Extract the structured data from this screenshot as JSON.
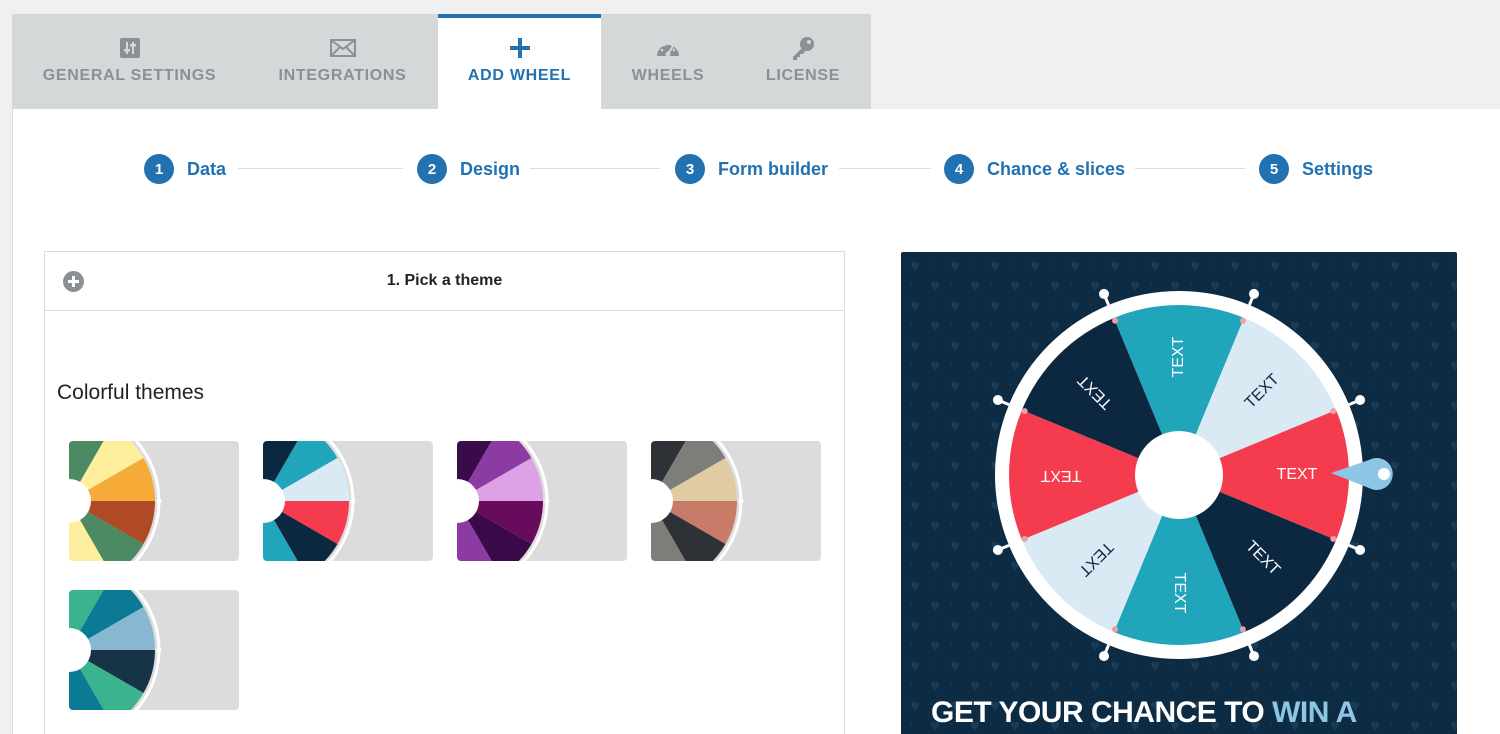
{
  "tabs": [
    {
      "label": "GENERAL SETTINGS",
      "icon": "sliders-icon"
    },
    {
      "label": "INTEGRATIONS",
      "icon": "envelope-icon"
    },
    {
      "label": "ADD WHEEL",
      "icon": "plus-icon",
      "active": true
    },
    {
      "label": "WHEELS",
      "icon": "dashboard-icon"
    },
    {
      "label": "LICENSE",
      "icon": "key-icon"
    }
  ],
  "steps": [
    {
      "num": "1",
      "label": "Data"
    },
    {
      "num": "2",
      "label": "Design"
    },
    {
      "num": "3",
      "label": "Form builder"
    },
    {
      "num": "4",
      "label": "Chance & slices"
    },
    {
      "num": "5",
      "label": "Settings"
    }
  ],
  "theme_box": {
    "title": "1. Pick a theme",
    "section_title": "Colorful themes",
    "themes": [
      {
        "name": "theme-1",
        "colors": [
          "#4b8a62",
          "#fdef9e",
          "#f6ab39",
          "#b04a26",
          "#4b8a62",
          "#fdef9e"
        ]
      },
      {
        "name": "theme-2",
        "colors": [
          "#0c2840",
          "#21a5bb",
          "#d9eaf4",
          "#f43c4e",
          "#0c2840",
          "#21a5bb"
        ]
      },
      {
        "name": "theme-3",
        "colors": [
          "#3a0a4a",
          "#8c3ba2",
          "#dda1e6",
          "#690b5c",
          "#3a0a4a",
          "#8c3ba2"
        ]
      },
      {
        "name": "theme-4",
        "colors": [
          "#2e3136",
          "#7d7e79",
          "#e1cba3",
          "#c77b68",
          "#2e3136",
          "#7d7e79"
        ]
      },
      {
        "name": "theme-5",
        "colors": [
          "#3bb38f",
          "#0b7a94",
          "#88b7d2",
          "#173446",
          "#3bb38f",
          "#0b7a94"
        ]
      }
    ]
  },
  "preview": {
    "slice_text": "TEXT",
    "promo_main": "GET YOUR CHANCE TO ",
    "promo_highlight": "WIN A",
    "colors": {
      "background": "#0d2b43",
      "navy": "#0c2840",
      "teal": "#21a5bb",
      "light": "#d9eaf4",
      "red": "#f43c4e"
    }
  },
  "accent": "#2271b1"
}
